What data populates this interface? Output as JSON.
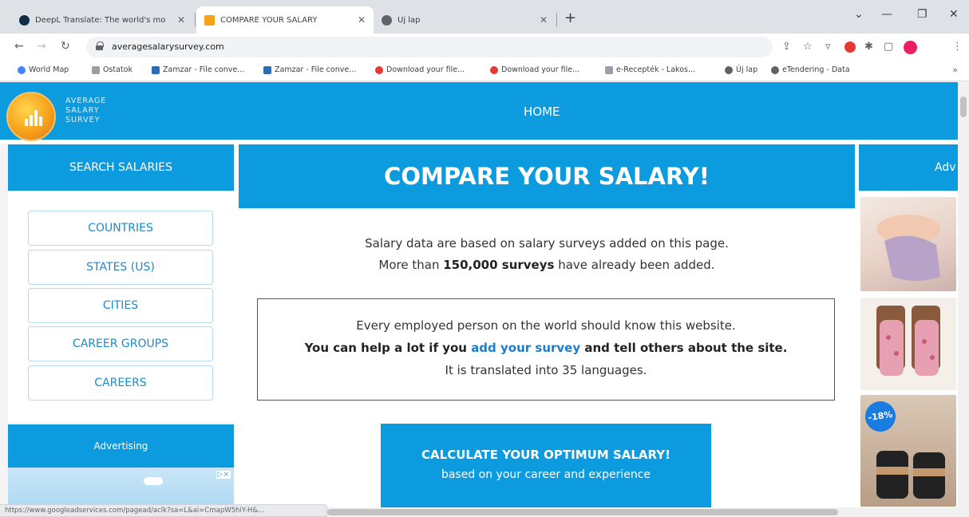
{
  "browser": {
    "tabs": [
      {
        "label": "DeepL Translate: The world's mo",
        "active": false
      },
      {
        "label": "COMPARE YOUR SALARY",
        "active": true
      },
      {
        "label": "Új lap",
        "active": false
      }
    ],
    "url": "averagesalarysurvey.com",
    "bookmarks": [
      "World Map",
      "Ostatok",
      "Zamzar - File conve...",
      "Zamzar - File conve...",
      "Download your file...",
      "Download your file...",
      "e-Recepték - Lakos...",
      "Új lap",
      "eTendering - Data"
    ],
    "status_url": "https://www.googleadservices.com/pagead/aclk?sa=L&ai=CmapW5hiY-H&...",
    "sale_badge": "-18%"
  },
  "site": {
    "logo_lines": [
      "AVERAGE",
      "SALARY",
      "SURVEY"
    ],
    "nav_home": "HOME",
    "search_title": "SEARCH SALARIES",
    "sidebar_buttons": [
      "COUNTRIES",
      "STATES (US)",
      "CITIES",
      "CAREER GROUPS",
      "CAREERS"
    ],
    "advertising": "Advertising",
    "ad_choice": "▷×",
    "right_head": "Adv",
    "main_title": "COMPARE YOUR SALARY!",
    "intro_line1": "Salary data are based on salary surveys added on this page.",
    "intro_pre": "More than ",
    "intro_bold": "150,000 surveys",
    "intro_post": " have already been added.",
    "box_line1": "Every employed person on the world should know this website.",
    "box_bold_pre": "You can help a lot if you ",
    "box_link": "add your survey",
    "box_bold_post": " and tell others about the site.",
    "box_line3": "It is translated into 35 languages.",
    "cta_title": "CALCULATE YOUR OPTIMUM SALARY!",
    "cta_sub": "based on your career and experience"
  },
  "colors": {
    "brand_blue": "#0d9be0",
    "link_blue": "#1a7ecf"
  }
}
